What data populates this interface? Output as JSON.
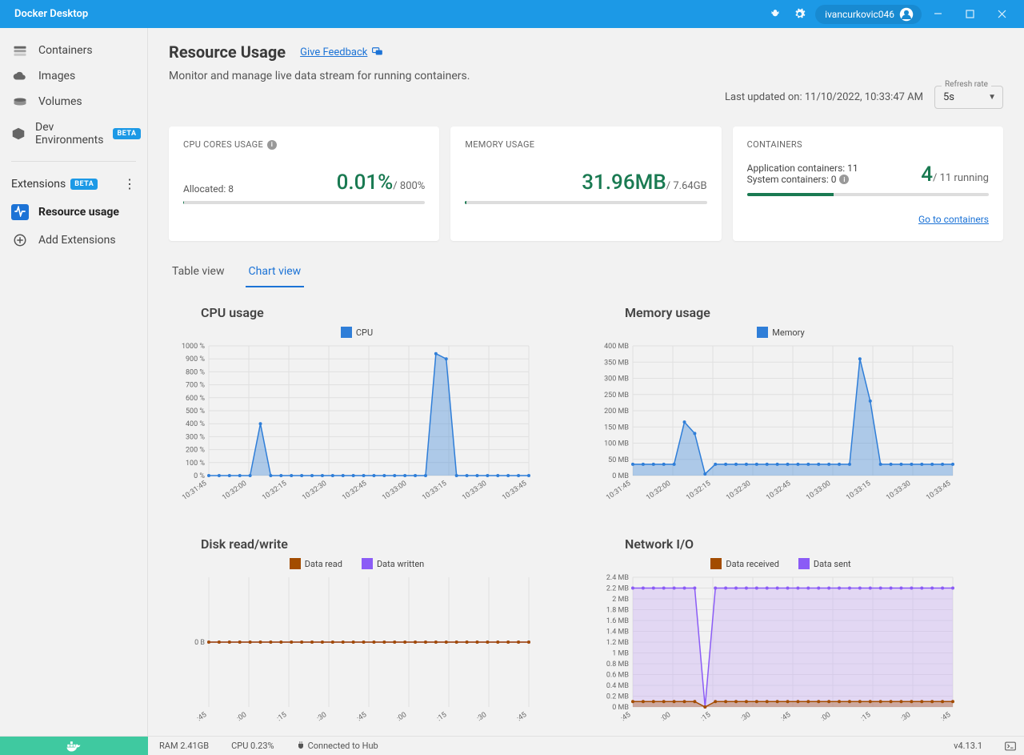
{
  "titlebar": {
    "app_name": "Docker Desktop",
    "username": "ivancurkovic046"
  },
  "sidebar": {
    "main_items": [
      {
        "label": "Containers",
        "icon": "layers"
      },
      {
        "label": "Images",
        "icon": "cloud"
      },
      {
        "label": "Volumes",
        "icon": "disk"
      },
      {
        "label": "Dev Environments",
        "icon": "cube",
        "badge": "BETA"
      }
    ],
    "extensions_header": "Extensions",
    "extensions_badge": "BETA",
    "ext_items": [
      {
        "label": "Resource usage",
        "active": true
      },
      {
        "label": "Add Extensions",
        "icon": "plus"
      }
    ]
  },
  "page": {
    "title": "Resource Usage",
    "feedback_label": "Give Feedback",
    "description": "Monitor and manage live data stream for running containers.",
    "last_updated_label": "Last updated on:",
    "last_updated_value": "11/10/2022, 10:33:47 AM",
    "refresh_label": "Refresh rate",
    "refresh_value": "5s"
  },
  "cards": {
    "cpu": {
      "title": "CPU CORES USAGE",
      "allocated_label": "Allocated: 8",
      "value": "0.01%",
      "suffix": "/ 800%"
    },
    "memory": {
      "title": "MEMORY USAGE",
      "value": "31.96MB",
      "suffix": "/ 7.64GB"
    },
    "containers": {
      "title": "CONTAINERS",
      "app_label": "Application containers: 11",
      "sys_label": "System containers: 0",
      "value": "4",
      "suffix": "/ 11 running",
      "link": "Go to containers"
    }
  },
  "tabs": {
    "table": "Table view",
    "chart": "Chart view"
  },
  "chart_labels": {
    "cpu": {
      "title": "CPU usage",
      "legend": "CPU"
    },
    "memory": {
      "title": "Memory usage",
      "legend": "Memory"
    },
    "disk": {
      "title": "Disk read/write",
      "legend_read": "Data read",
      "legend_written": "Data written"
    },
    "network": {
      "title": "Network I/O",
      "legend_rx": "Data received",
      "legend_tx": "Data sent"
    }
  },
  "footer": {
    "ram": "RAM 2.41GB",
    "cpu": "CPU 0.23%",
    "connected": "Connected to Hub",
    "version": "v4.13.1"
  },
  "chart_data": [
    {
      "id": "cpu",
      "type": "area",
      "title": "CPU usage",
      "xlabel": "",
      "ylabel": "",
      "x_ticks": [
        "10:31:45",
        "10:32:00",
        "10:32:15",
        "10:32:30",
        "10:32:45",
        "10:33:00",
        "10:33:15",
        "10:33:30",
        "10:33:45"
      ],
      "y_ticks": [
        "0 %",
        "100 %",
        "200 %",
        "300 %",
        "400 %",
        "500 %",
        "600 %",
        "700 %",
        "800 %",
        "900 %",
        "1000 %"
      ],
      "ylim": [
        0,
        1000
      ],
      "series": [
        {
          "name": "CPU",
          "color": "#2f7ed8",
          "values": [
            0,
            0,
            0,
            0,
            0,
            400,
            0,
            0,
            0,
            0,
            0,
            0,
            0,
            0,
            0,
            0,
            0,
            0,
            0,
            0,
            0,
            0,
            940,
            900,
            0,
            0,
            0,
            0,
            0,
            0,
            0,
            0
          ]
        }
      ]
    },
    {
      "id": "memory",
      "type": "area",
      "title": "Memory usage",
      "x_ticks": [
        "10:31:45",
        "10:32:00",
        "10:32:15",
        "10:32:30",
        "10:32:45",
        "10:33:00",
        "10:33:15",
        "10:33:30",
        "10:33:45"
      ],
      "y_ticks": [
        "0 MB",
        "50 MB",
        "100 MB",
        "150 MB",
        "200 MB",
        "250 MB",
        "300 MB",
        "350 MB",
        "400 MB"
      ],
      "ylim": [
        0,
        400
      ],
      "series": [
        {
          "name": "Memory",
          "color": "#2f7ed8",
          "values": [
            35,
            35,
            35,
            35,
            35,
            165,
            130,
            5,
            35,
            35,
            35,
            35,
            35,
            35,
            35,
            35,
            35,
            35,
            35,
            35,
            35,
            35,
            360,
            230,
            35,
            35,
            35,
            35,
            35,
            35,
            35,
            35
          ]
        }
      ]
    },
    {
      "id": "disk",
      "type": "line",
      "title": "Disk read/write",
      "x_ticks": [
        ":45",
        ":00",
        ":15",
        ":30",
        ":45",
        ":00",
        ":15",
        ":30",
        ":45"
      ],
      "y_ticks": [
        "0 B"
      ],
      "ylim": [
        -1,
        1
      ],
      "series": [
        {
          "name": "Data read",
          "color": "#a34c00",
          "values": [
            0,
            0,
            0,
            0,
            0,
            0,
            0,
            0,
            0,
            0,
            0,
            0,
            0,
            0,
            0,
            0,
            0,
            0,
            0,
            0,
            0,
            0,
            0,
            0,
            0,
            0,
            0,
            0,
            0,
            0,
            0,
            0
          ]
        },
        {
          "name": "Data written",
          "color": "#8b5cf6",
          "values": [
            0,
            0,
            0,
            0,
            0,
            0,
            0,
            0,
            0,
            0,
            0,
            0,
            0,
            0,
            0,
            0,
            0,
            0,
            0,
            0,
            0,
            0,
            0,
            0,
            0,
            0,
            0,
            0,
            0,
            0,
            0,
            0
          ]
        }
      ]
    },
    {
      "id": "network",
      "type": "area",
      "title": "Network I/O",
      "x_ticks": [
        ":45",
        ":00",
        ":15",
        ":30",
        ":45",
        ":00",
        ":15",
        ":30",
        ":45"
      ],
      "y_ticks": [
        "0 MB",
        "0.2 MB",
        "0.4 MB",
        "0.6 MB",
        "0.8 MB",
        "1 MB",
        "1.2 MB",
        "1.4 MB",
        "1.6 MB",
        "1.8 MB",
        "2 MB",
        "2.2 MB",
        "2.4 MB"
      ],
      "ylim": [
        0,
        2.4
      ],
      "series": [
        {
          "name": "Data received",
          "color": "#a34c00",
          "values": [
            0.1,
            0.1,
            0.1,
            0.1,
            0.1,
            0.1,
            0.1,
            0,
            0.1,
            0.1,
            0.1,
            0.1,
            0.1,
            0.1,
            0.1,
            0.1,
            0.1,
            0.1,
            0.1,
            0.1,
            0.1,
            0.1,
            0.1,
            0.1,
            0.1,
            0.1,
            0.1,
            0.1,
            0.1,
            0.1,
            0.1,
            0.1
          ]
        },
        {
          "name": "Data sent",
          "color": "#8b5cf6",
          "fill": "#c6a6f5",
          "values": [
            2.2,
            2.2,
            2.2,
            2.2,
            2.2,
            2.2,
            2.2,
            0,
            2.2,
            2.2,
            2.2,
            2.2,
            2.2,
            2.2,
            2.2,
            2.2,
            2.2,
            2.2,
            2.2,
            2.2,
            2.2,
            2.2,
            2.2,
            2.2,
            2.2,
            2.2,
            2.2,
            2.2,
            2.2,
            2.2,
            2.2,
            2.2
          ]
        }
      ]
    }
  ]
}
